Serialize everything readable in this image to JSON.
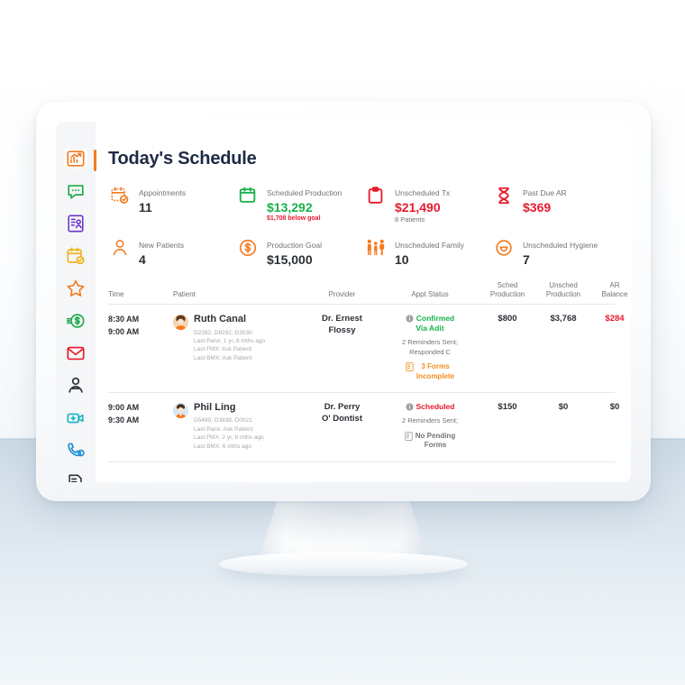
{
  "window": {
    "dots": [
      {
        "name": "close",
        "color": "#ee2f2a"
      },
      {
        "name": "minimize",
        "color": "#f5b518"
      },
      {
        "name": "maximize",
        "color": "#25ac3f"
      }
    ]
  },
  "sidebar": {
    "items": [
      {
        "name": "analytics-chart-icon",
        "label": "Analytics",
        "color": "#f47b20",
        "active": true
      },
      {
        "name": "chat-bubble-icon",
        "label": "Messages",
        "color": "#1faa4b",
        "active": false
      },
      {
        "name": "patient-record-icon",
        "label": "Patient Records",
        "color": "#6b37c9",
        "active": false
      },
      {
        "name": "calendar-check-icon",
        "label": "Schedule",
        "color": "#f0b323",
        "active": false
      },
      {
        "name": "star-icon",
        "label": "Reviews",
        "color": "#f47b20",
        "active": false
      },
      {
        "name": "payments-dollar-icon",
        "label": "Payments",
        "color": "#1faa4b",
        "active": false
      },
      {
        "name": "mail-envelope-icon",
        "label": "Email",
        "color": "#e8192c",
        "active": false
      },
      {
        "name": "user-profile-icon",
        "label": "Profile",
        "color": "#2b3036",
        "active": false
      },
      {
        "name": "video-call-icon",
        "label": "Video Visit",
        "color": "#13b5c4",
        "active": false
      },
      {
        "name": "phone-call-icon",
        "label": "Calls",
        "color": "#1c8bd6",
        "active": false
      },
      {
        "name": "reports-document-icon",
        "label": "Reports",
        "color": "#2b3036",
        "active": false
      }
    ]
  },
  "header": {
    "title": "Today's Schedule"
  },
  "kpis": [
    {
      "icon": "calendar-appointments-icon",
      "icon_color": "#f47b20",
      "label": "Appointments",
      "value": "11",
      "value_color": "dark",
      "sub": "",
      "sub_style": ""
    },
    {
      "icon": "calendar-production-icon",
      "icon_color": "#17b14b",
      "label": "Scheduled Production",
      "value": "$13,292",
      "value_color": "green",
      "sub": "$1,708 below goal",
      "sub_style": "red"
    },
    {
      "icon": "clipboard-unscheduled-icon",
      "icon_color": "#e8192c",
      "label": "Unscheduled Tx",
      "value": "$21,490",
      "value_color": "red",
      "sub": "8 Patients",
      "sub_style": "grey"
    },
    {
      "icon": "hourglass-past-due-icon",
      "icon_color": "#e8192c",
      "label": "Past Due AR",
      "value": "$369",
      "value_color": "red",
      "sub": "",
      "sub_style": ""
    },
    {
      "icon": "person-new-patient-icon",
      "icon_color": "#f47b20",
      "label": "New Patients",
      "value": "4",
      "value_color": "dark",
      "sub": "",
      "sub_style": ""
    },
    {
      "icon": "dollar-coin-goal-icon",
      "icon_color": "#f47b20",
      "label": "Production Goal",
      "value": "$15,000",
      "value_color": "dark",
      "sub": "",
      "sub_style": ""
    },
    {
      "icon": "family-group-icon",
      "icon_color": "#f47b20",
      "label": "Unscheduled Family",
      "value": "10",
      "value_color": "dark",
      "sub": "",
      "sub_style": ""
    },
    {
      "icon": "tooth-hygiene-icon",
      "icon_color": "#f47b20",
      "label": "Unscheduled Hygiene",
      "value": "7",
      "value_color": "dark",
      "sub": "",
      "sub_style": ""
    }
  ],
  "table": {
    "columns": [
      {
        "key": "time",
        "label": "Time",
        "align": "left"
      },
      {
        "key": "patient",
        "label": "Patient",
        "align": "left"
      },
      {
        "key": "provider",
        "label": "Provider",
        "align": "center"
      },
      {
        "key": "appt_status",
        "label": "Appt Status",
        "align": "center"
      },
      {
        "key": "sched_production",
        "label": "Sched\nProduction",
        "align": "center"
      },
      {
        "key": "unsched_production",
        "label": "Unsched\nProduction",
        "align": "center"
      },
      {
        "key": "ar_balance",
        "label": "AR\nBalance",
        "align": "center"
      }
    ],
    "column_labels": {
      "time": "Time",
      "patient": "Patient",
      "provider": "Provider",
      "appt_status": "Appt Status",
      "sched_production_l1": "Sched",
      "sched_production_l2": "Production",
      "unsched_production_l1": "Unsched",
      "unsched_production_l2": "Production",
      "ar_balance_l1": "AR",
      "ar_balance_l2": "Balance"
    },
    "rows": [
      {
        "time_start": "8:30 AM",
        "time_end": "9:00 AM",
        "patient_name": "Ruth Canal",
        "avatar": "female-avatar",
        "codes": "D2392, D9292, D3030",
        "last_pano": "Last Pano: 1 yr, 8 mths ago",
        "last_fmx": "Last FMX: Ask Patient",
        "last_bmx": "Last BMX: Ask Patient",
        "provider_l1": "Dr. Ernest",
        "provider_l2": "Flossy",
        "status_icon": "info-icon",
        "status_main": "Confirmed",
        "status_main_l2": "Via Adit",
        "status_color": "green",
        "status_note_l1": "2 Reminders Sent;",
        "status_note_l2": "Responded C",
        "forms_icon": "form-icon",
        "forms_l1": "3 Forms",
        "forms_l2": "Incomplete",
        "forms_color": "orange",
        "sched_production": "$800",
        "unsched_production": "$3,768",
        "ar_balance": "$284",
        "ar_balance_color": "red"
      },
      {
        "time_start": "9:00 AM",
        "time_end": "9:30 AM",
        "patient_name": "Phil Ling",
        "avatar": "male-avatar",
        "codes": "D5499, D3838, D0021",
        "last_pano": "Last Pano: Ask Patient",
        "last_fmx": "Last FMX: 2 yr, 8 mths ago",
        "last_bmx": "Last BMX: 6 mths ago",
        "provider_l1": "Dr. Perry",
        "provider_l2": "O' Dontist",
        "status_icon": "info-icon",
        "status_main": "Scheduled",
        "status_main_l2": "",
        "status_color": "red",
        "status_note_l1": "2 Reminders Sent;",
        "status_note_l2": "",
        "forms_icon": "form-icon",
        "forms_l1": "No Pending",
        "forms_l2": "Forms",
        "forms_color": "grey",
        "sched_production": "$150",
        "unsched_production": "$0",
        "ar_balance": "$0",
        "ar_balance_color": "dark"
      }
    ]
  }
}
